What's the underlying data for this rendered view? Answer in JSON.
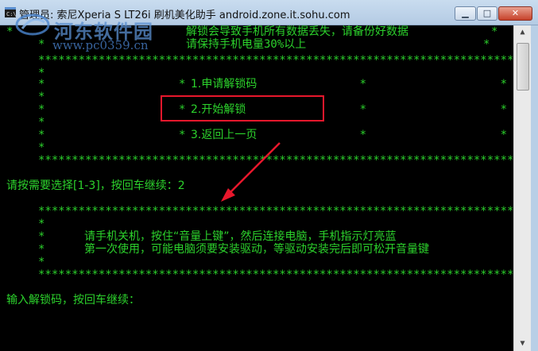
{
  "window": {
    "title": "管理员: 索尼Xperia S LT26i 刷机美化助手 android.zone.it.sohu.com",
    "controls": {
      "minimize": "▁",
      "maximize": "□",
      "close": "✕"
    }
  },
  "watermark": {
    "name": "河东软件园",
    "url": "www.pc0359.cn"
  },
  "console": {
    "warning_line1": "解锁会导致手机所有数据丢失，请备份好数据",
    "warning_line2": "请保持手机电量30%以上",
    "menu": {
      "item1": "1.申请解锁码",
      "item2": "2.开始解锁",
      "item3": "3.返回上一页"
    },
    "prompt_choice": "请按需要选择[1-3]，按回车继续：2",
    "instructions_line1": "请手机关机，按住“音量上键”，然后连接电脑，手机指示灯亮蓝",
    "instructions_line2": "第一次使用，可能电脑须要安装驱动，等驱动安装完后即可松开音量键",
    "prompt_unlock": "输入解锁码，按回车继续："
  },
  "annotation": {
    "highlight_color": "#e8172c",
    "arrow_color": "#e8172c"
  },
  "colors": {
    "console_text": "#2cd22c",
    "console_bg": "#000000"
  },
  "icons": {
    "title": "console-window-icon"
  }
}
